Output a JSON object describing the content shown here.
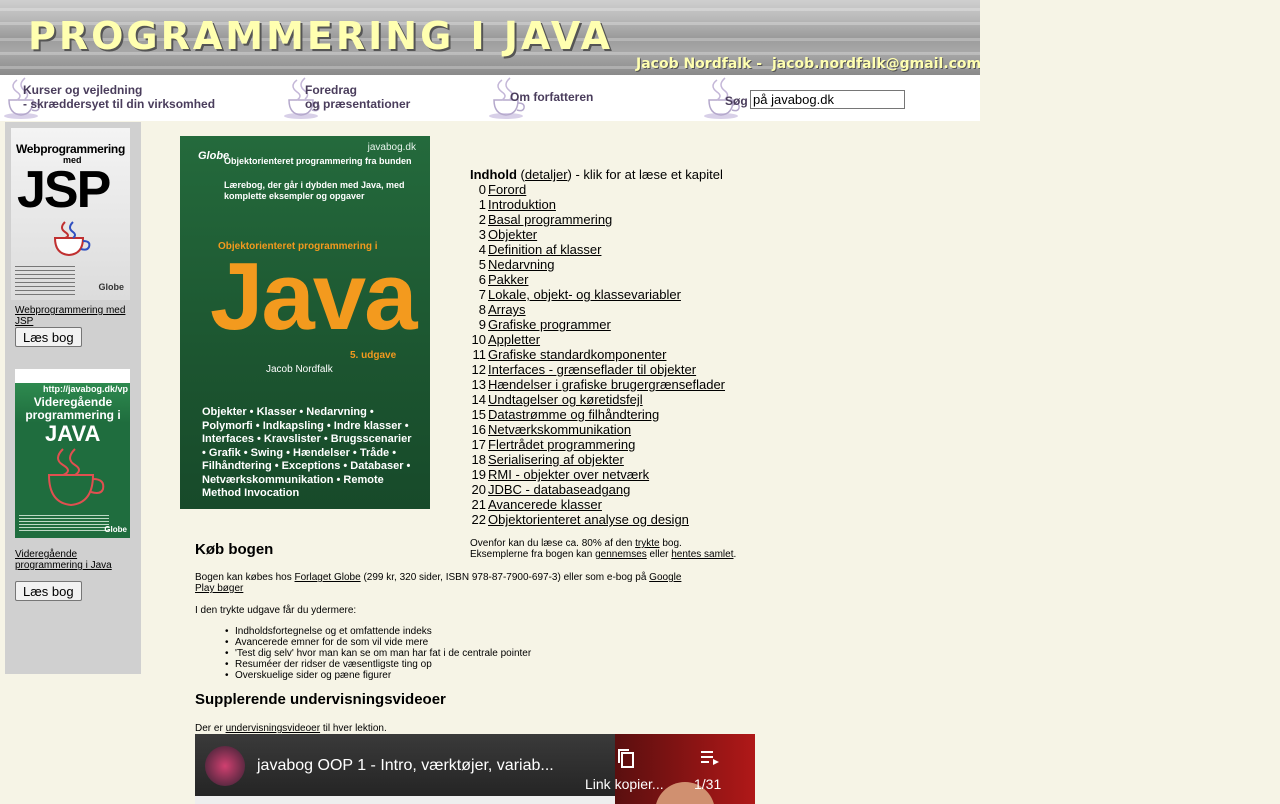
{
  "banner": {
    "title": "PROGRAMMERING I  JAVA",
    "author": "Jacob Nordfalk -",
    "email": "jacob.nordfalk@gmail.com"
  },
  "nav": {
    "courses_line1": "Kurser og vejledning",
    "courses_line2": " - skræddersyet til din virksomhed",
    "talks_line1": "Foredrag",
    "talks_line2": " og præsentationer",
    "about": "Om forfatteren",
    "search_label": "Søg",
    "search_value": "på javabog.dk"
  },
  "sidebar": {
    "book1": {
      "cover_title_top": "Webprogrammering",
      "cover_title_med": "med",
      "cover_title_big": "JSP",
      "link": "Webprogrammering med JSP",
      "button": "Læs bog"
    },
    "book2": {
      "cover_url": "http://javabog.dk/vp",
      "cover_title": "Videregående programmering i",
      "cover_title_big": "JAVA",
      "link": "Videregående programmering i Java",
      "button": "Læs bog"
    }
  },
  "cover": {
    "site": "javabog.dk",
    "publisher": "Globe",
    "bullet1": "Objektorienteret programmering fra bunden",
    "bullet2": "Lærebog, der går i dybden med Java, med komplette eksempler og opgaver",
    "subtitle": "Objektorienteret programmering i",
    "big": "Java",
    "edition": "5. udgave",
    "author": "Jacob Nordfalk",
    "topics": "Objekter • Klasser • Nedarvning • Polymorfi • Indkapsling • Indre klasser • Interfaces • Kravslister • Brugsscenarier • Grafik • Swing • Hændelser • Tråde • Filhåndtering • Exceptions • Databaser • Netværkskommunikation • Remote Method Invocation"
  },
  "toc": {
    "heading": "Indhold",
    "details_link": "detaljer",
    "suffix": ") - klik for at læse et kapitel",
    "chapters": [
      {
        "num": "0",
        "title": "Forord"
      },
      {
        "num": "1",
        "title": "Introduktion"
      },
      {
        "num": "2",
        "title": "Basal programmering"
      },
      {
        "num": "3",
        "title": "Objekter"
      },
      {
        "num": "4",
        "title": "Definition af klasser"
      },
      {
        "num": "5",
        "title": "Nedarvning"
      },
      {
        "num": "6",
        "title": "Pakker"
      },
      {
        "num": "7",
        "title": "Lokale, objekt- og klassevariabler"
      },
      {
        "num": "8",
        "title": "Arrays"
      },
      {
        "num": "9",
        "title": "Grafiske programmer"
      },
      {
        "num": "10",
        "title": "Appletter"
      },
      {
        "num": "11",
        "title": "Grafiske standardkomponenter"
      },
      {
        "num": "12",
        "title": "Interfaces - grænseflader til objekter"
      },
      {
        "num": "13",
        "title": "Hændelser i grafiske brugergrænseflader"
      },
      {
        "num": "14",
        "title": "Undtagelser og køretidsfejl"
      },
      {
        "num": "15",
        "title": "Datastrømme og filhåndtering"
      },
      {
        "num": "16",
        "title": "Netværkskommunikation"
      },
      {
        "num": "17",
        "title": "Flertrådet programmering"
      },
      {
        "num": "18",
        "title": "Serialisering af objekter"
      },
      {
        "num": "19",
        "title": "RMI - objekter over netværk"
      },
      {
        "num": "20",
        "title": "JDBC - databaseadgang"
      },
      {
        "num": "21",
        "title": "Avancerede klasser"
      },
      {
        "num": "22",
        "title": "Objektorienteret analyse og design"
      }
    ],
    "note_prefix": "Ovenfor kan du læse ca. 80% af den ",
    "note_link1": "trykte",
    "note_mid": " bog.",
    "note_line2_prefix": "Eksemplerne fra bogen kan ",
    "note_link2": "gennemses",
    "note_or": " eller ",
    "note_link3": "hentes samlet",
    "note_end": "."
  },
  "buy": {
    "heading": "Køb bogen",
    "text_prefix": "Bogen kan købes hos ",
    "publisher_link": "Forlaget Globe",
    "text_mid": " (299 kr, 320 sider, ISBN 978-87-7900-697-3) eller som e-bog på ",
    "google_link": "Google Play bøger",
    "extras_intro": "I den trykte udgave får du ydermere:",
    "extras": [
      "Indholdsfortegnelse og et omfattende indeks",
      "Avancerede emner for de som vil vide mere",
      "'Test dig selv' hvor man kan se om man har fat i de centrale pointer",
      "Resuméer der ridser de væsentligste ting op",
      "Overskuelige sider og pæne figurer"
    ]
  },
  "videos": {
    "heading": "Supplerende undervisningsvideoer",
    "text_prefix": "Der er ",
    "link": "undervisningsvideoer",
    "text_suffix": " til hver lektion.",
    "player_title": "javabog OOP 1 - Intro, værktøjer, variab...",
    "copy_label": "Link kopier...",
    "playlist_count": "1/31"
  },
  "colors": {
    "page_bg": "#f6f4e6",
    "sidebar_bg": "#d0d0d0",
    "nav_text": "#4a3d5c",
    "banner_text": "#ffffb0",
    "cover_green": "#1d5a33",
    "cover_orange": "#f39a1e"
  }
}
